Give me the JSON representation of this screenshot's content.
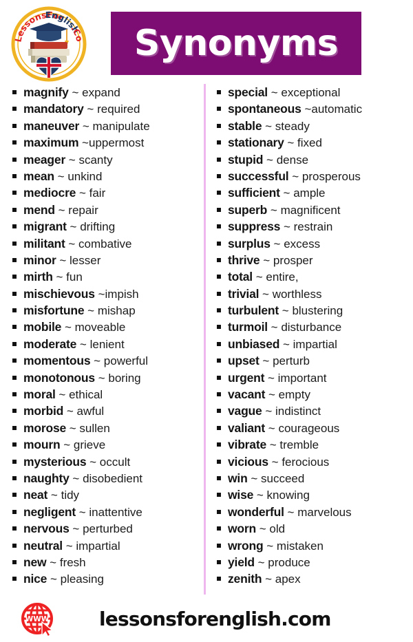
{
  "header": {
    "title": "Synonyms",
    "title_bg": "#7d0d73",
    "logo": {
      "name": "lessons-for-english-logo",
      "ring_color": "#f0b323",
      "text_top": "LessonsForEnglish",
      "text_suffix": ".Com",
      "text_color_red": "#e02020",
      "text_color_navy": "#1f3864"
    }
  },
  "divider": {
    "color": "#eeb8ee"
  },
  "columns": {
    "left": [
      {
        "word": "magnify",
        "tilde": "~",
        "synonym": "expand"
      },
      {
        "word": "mandatory",
        "tilde": "~",
        "synonym": "required"
      },
      {
        "word": "maneuver",
        "tilde": "~",
        "synonym": "manipulate"
      },
      {
        "word": "maximum",
        "tilde": "~",
        "synonym": "uppermost",
        "tight": true
      },
      {
        "word": "meager",
        "tilde": "~",
        "synonym": "scanty"
      },
      {
        "word": "mean",
        "tilde": "~",
        "synonym": "unkind"
      },
      {
        "word": "mediocre",
        "tilde": "~",
        "synonym": "fair"
      },
      {
        "word": "mend",
        "tilde": "~",
        "synonym": "repair"
      },
      {
        "word": "migrant",
        "tilde": "~",
        "synonym": "drifting"
      },
      {
        "word": "militant",
        "tilde": "~",
        "synonym": "combative"
      },
      {
        "word": "minor",
        "tilde": "~",
        "synonym": "lesser"
      },
      {
        "word": "mirth",
        "tilde": "~",
        "synonym": "fun"
      },
      {
        "word": "mischievous",
        "tilde": "~",
        "synonym": "impish",
        "tight": true
      },
      {
        "word": "misfortune",
        "tilde": "~",
        "synonym": "mishap"
      },
      {
        "word": "mobile",
        "tilde": "~",
        "synonym": "moveable"
      },
      {
        "word": "moderate",
        "tilde": "~",
        "synonym": "lenient"
      },
      {
        "word": "momentous",
        "tilde": "~",
        "synonym": "powerful"
      },
      {
        "word": "monotonous",
        "tilde": "~",
        "synonym": "boring"
      },
      {
        "word": "moral",
        "tilde": "~",
        "synonym": "ethical"
      },
      {
        "word": "morbid",
        "tilde": "~",
        "synonym": "awful"
      },
      {
        "word": "morose",
        "tilde": "~",
        "synonym": "sullen"
      },
      {
        "word": "mourn",
        "tilde": "~",
        "synonym": "grieve"
      },
      {
        "word": "mysterious",
        "tilde": "~",
        "synonym": "occult"
      },
      {
        "word": "naughty",
        "tilde": "~",
        "synonym": "disobedient"
      },
      {
        "word": "neat",
        "tilde": "~",
        "synonym": "tidy"
      },
      {
        "word": "negligent",
        "tilde": "~",
        "synonym": "inattentive"
      },
      {
        "word": "nervous",
        "tilde": "~",
        "synonym": "perturbed"
      },
      {
        "word": "neutral",
        "tilde": "~",
        "synonym": "impartial"
      },
      {
        "word": "new",
        "tilde": "~",
        "synonym": "fresh"
      },
      {
        "word": "nice",
        "tilde": "~",
        "synonym": "pleasing"
      }
    ],
    "right": [
      {
        "word": "special",
        "tilde": "~",
        "synonym": "exceptional"
      },
      {
        "word": "spontaneous",
        "tilde": "~",
        "synonym": "automatic",
        "tight": true
      },
      {
        "word": "stable",
        "tilde": "~",
        "synonym": "steady"
      },
      {
        "word": "stationary",
        "tilde": "~",
        "synonym": "fixed"
      },
      {
        "word": "stupid",
        "tilde": "~",
        "synonym": "dense"
      },
      {
        "word": "successful",
        "tilde": "~",
        "synonym": "prosperous"
      },
      {
        "word": "sufficient",
        "tilde": "~",
        "synonym": "ample"
      },
      {
        "word": "superb",
        "tilde": "~",
        "synonym": "magnificent"
      },
      {
        "word": "suppress",
        "tilde": "~",
        "synonym": "restrain"
      },
      {
        "word": "surplus",
        "tilde": "~",
        "synonym": "excess"
      },
      {
        "word": "thrive",
        "tilde": "~",
        "synonym": "prosper"
      },
      {
        "word": "total",
        "tilde": "~",
        "synonym": "entire,"
      },
      {
        "word": "trivial",
        "tilde": "~",
        "synonym": "worthless"
      },
      {
        "word": "turbulent",
        "tilde": "~",
        "synonym": "blustering"
      },
      {
        "word": "turmoil",
        "tilde": "~",
        "synonym": "disturbance"
      },
      {
        "word": "unbiased",
        "tilde": "~",
        "synonym": "impartial"
      },
      {
        "word": "upset",
        "tilde": "~",
        "synonym": "perturb"
      },
      {
        "word": "urgent",
        "tilde": "~",
        "synonym": "important"
      },
      {
        "word": "vacant",
        "tilde": "~",
        "synonym": "empty"
      },
      {
        "word": "vague",
        "tilde": "~",
        "synonym": "indistinct"
      },
      {
        "word": "valiant",
        "tilde": "~",
        "synonym": "courageous"
      },
      {
        "word": "vibrate",
        "tilde": "~",
        "synonym": "tremble"
      },
      {
        "word": "vicious",
        "tilde": "~",
        "synonym": "ferocious"
      },
      {
        "word": "win",
        "tilde": "~",
        "synonym": "succeed"
      },
      {
        "word": "wise",
        "tilde": "~",
        "synonym": "knowing"
      },
      {
        "word": "wonderful",
        "tilde": "~",
        "synonym": "marvelous"
      },
      {
        "word": "worn",
        "tilde": "~",
        "synonym": "old"
      },
      {
        "word": "wrong",
        "tilde": "~",
        "synonym": "mistaken"
      },
      {
        "word": "yield",
        "tilde": "~",
        "synonym": "produce"
      },
      {
        "word": "zenith",
        "tilde": "~",
        "synonym": "apex"
      }
    ]
  },
  "footer": {
    "icon_name": "www-globe-cursor-icon",
    "icon_color": "#ee2222",
    "icon_label": "WWW",
    "website": "lessonsforenglish.com"
  }
}
